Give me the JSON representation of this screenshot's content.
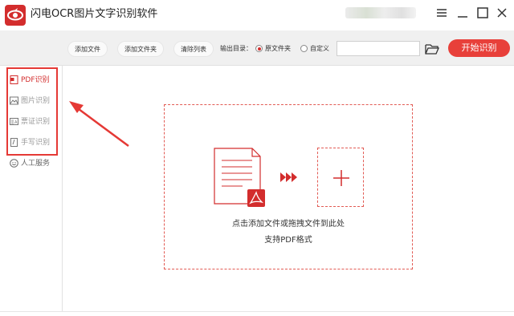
{
  "app": {
    "title": "闪电OCR图片文字识别软件"
  },
  "toolbar": {
    "add_file": "添加文件",
    "add_folder": "添加文件夹",
    "clear_list": "清除列表",
    "output_label": "输出目录：",
    "radio_original": "原文件夹",
    "radio_custom": "自定义",
    "path_value": "",
    "start": "开始识别"
  },
  "sidebar": {
    "items": [
      {
        "label": "PDF识别",
        "active": true
      },
      {
        "label": "图片识别"
      },
      {
        "label": "票证识别"
      },
      {
        "label": "手写识别"
      },
      {
        "label": "人工服务"
      }
    ]
  },
  "main": {
    "hint_line1": "点击添加文件或拖拽文件到此处",
    "hint_line2": "支持PDF格式"
  },
  "colors": {
    "accent": "#e8403a",
    "brand": "#d32d2d",
    "annotation": "#e53935"
  }
}
